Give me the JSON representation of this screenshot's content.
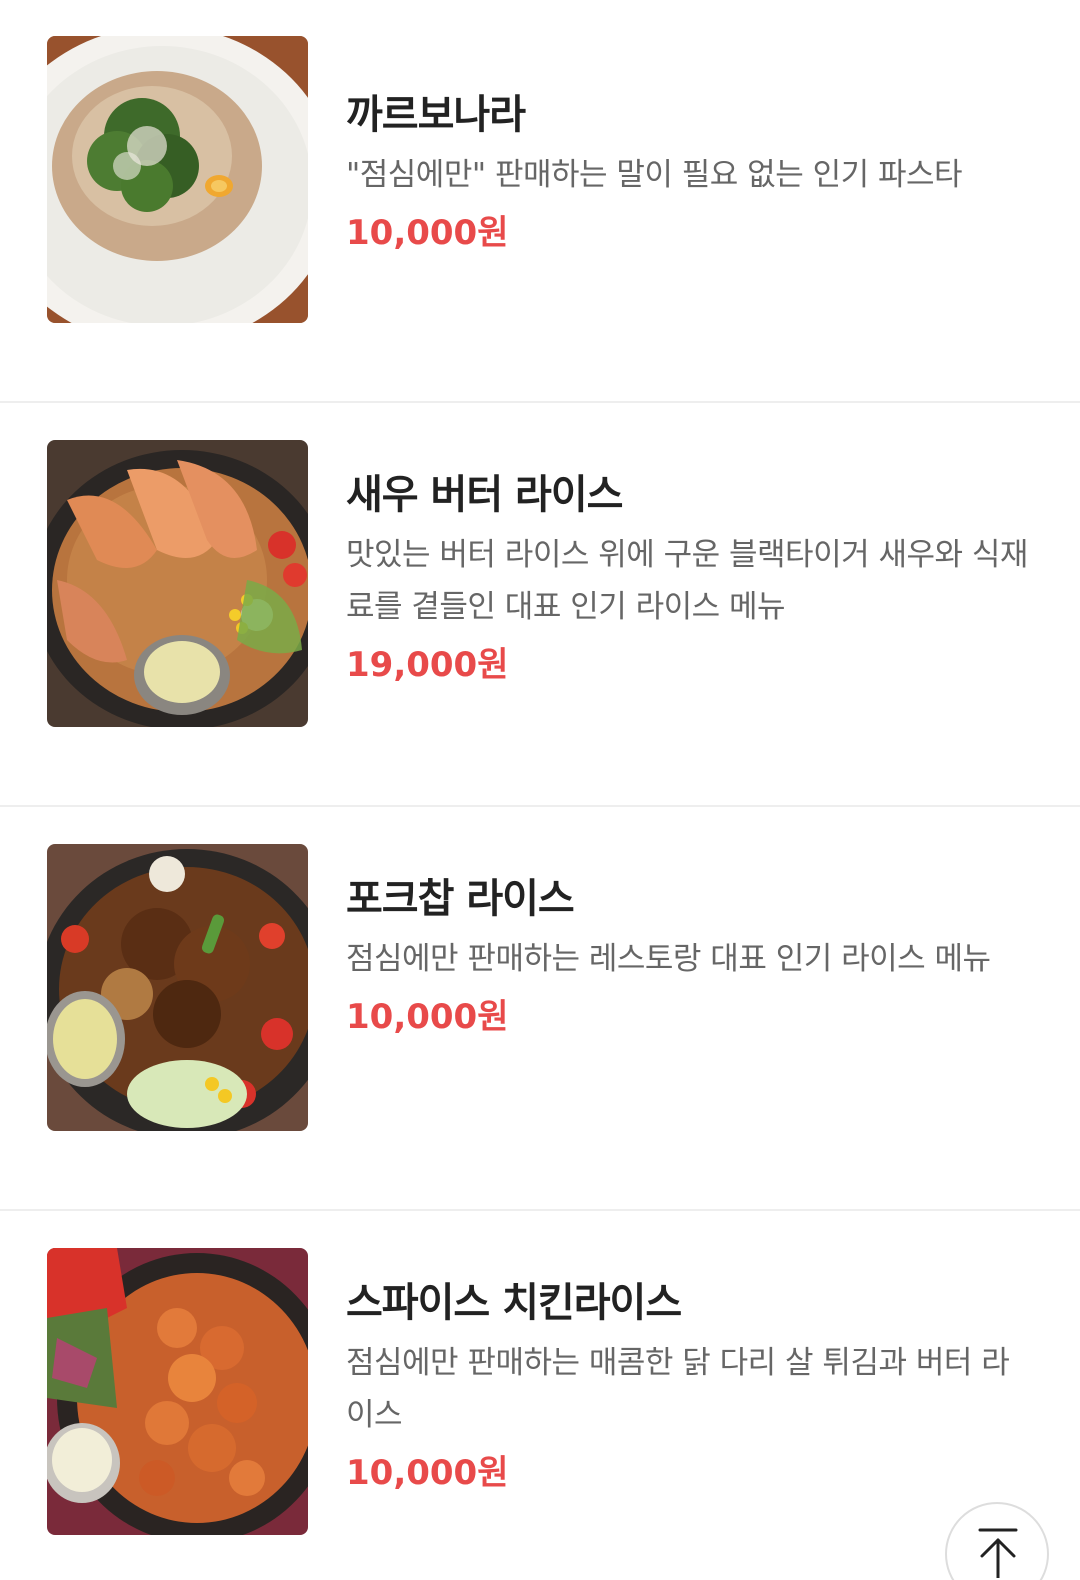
{
  "menu": {
    "items": [
      {
        "name": "까르보나라",
        "description": "\"점심에만\" 판매하는 말이 필요 없는 인기 파스타",
        "price": "10,000원"
      },
      {
        "name": "새우 버터 라이스",
        "description": "맛있는 버터 라이스 위에 구운 블랙타이거 새우와 식재료를 곁들인 대표 인기 라이스 메뉴",
        "price": "19,000원"
      },
      {
        "name": "포크찹 라이스",
        "description": "점심에만 판매하는 레스토랑 대표 인기 라이스 메뉴",
        "price": "10,000원"
      },
      {
        "name": "스파이스 치킨라이스",
        "description": "점심에만 판매하는 매콤한 닭 다리 살 튀김과 버터 라이스",
        "price": "10,000원"
      }
    ]
  },
  "scroll_top": {
    "icon": "arrow-up-to-top-icon"
  },
  "colors": {
    "price": "#e84a4a",
    "name": "#222222",
    "description": "#666666",
    "divider": "#eeeeee"
  }
}
